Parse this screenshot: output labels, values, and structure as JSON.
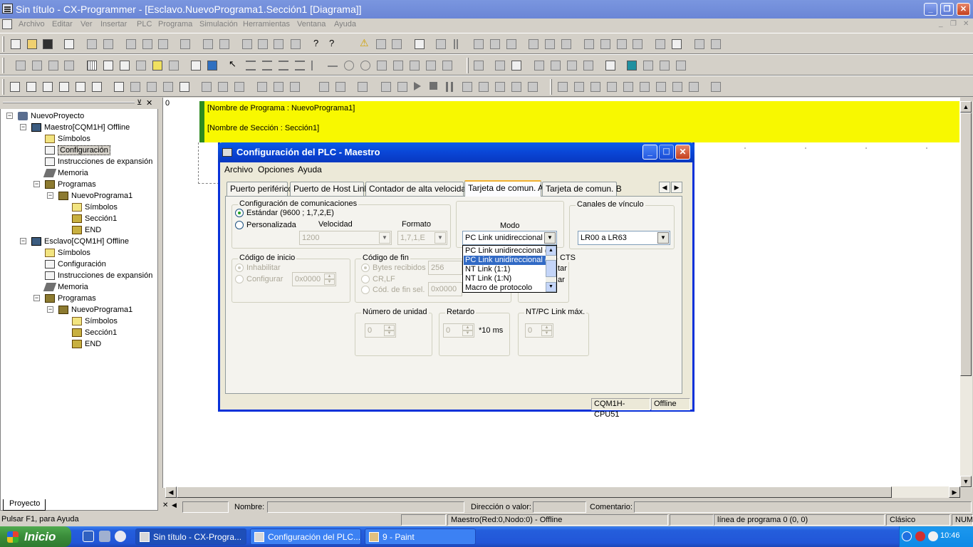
{
  "window": {
    "title": "Sin título - CX-Programmer - [Esclavo.NuevoPrograma1.Sección1 [Diagrama]]"
  },
  "menu": [
    "Archivo",
    "Editar",
    "Ver",
    "Insertar",
    "PLC",
    "Programa",
    "Simulación",
    "Herramientas",
    "Ventana",
    "Ayuda"
  ],
  "project_tree": {
    "items": [
      {
        "label": "NuevoProyecto",
        "icon": "network-icon"
      },
      {
        "label": "Maestro[CQM1H] Offline",
        "icon": "plc-icon"
      },
      {
        "label": "Símbolos",
        "icon": "symbols-icon"
      },
      {
        "label": "Configuración",
        "icon": "config-icon"
      },
      {
        "label": "Instrucciones de expansión",
        "icon": "instructions-icon"
      },
      {
        "label": "Memoria",
        "icon": "memory-icon"
      },
      {
        "label": "Programas",
        "icon": "programs-icon"
      },
      {
        "label": "NuevoPrograma1",
        "icon": "program-icon"
      },
      {
        "label": "Símbolos",
        "icon": "symbols-icon"
      },
      {
        "label": "Sección1",
        "icon": "section-icon"
      },
      {
        "label": "END",
        "icon": "section-icon"
      },
      {
        "label": "Esclavo[CQM1H] Offline",
        "icon": "plc-icon"
      },
      {
        "label": "Símbolos",
        "icon": "symbols-icon"
      },
      {
        "label": "Configuración",
        "icon": "config-icon"
      },
      {
        "label": "Instrucciones de expansión",
        "icon": "instructions-icon"
      },
      {
        "label": "Memoria",
        "icon": "memory-icon"
      },
      {
        "label": "Programas",
        "icon": "programs-icon"
      },
      {
        "label": "NuevoPrograma1",
        "icon": "program-icon"
      },
      {
        "label": "Símbolos",
        "icon": "symbols-icon"
      },
      {
        "label": "Sección1",
        "icon": "section-icon"
      },
      {
        "label": "END",
        "icon": "section-icon"
      }
    ],
    "tab_label": "Proyecto"
  },
  "diagram": {
    "rung_number": "0",
    "program_name": "[Nombre de Programa : NuevoPrograma1]",
    "section_name": "[Nombre de Sección : Sección1]"
  },
  "inner_status": {
    "nombre_label": "Nombre:",
    "direccion_label": "Dirección o valor:",
    "comentario_label": "Comentario:"
  },
  "statusbar": {
    "help": "Pulsar F1, para Ayuda",
    "plc": "Maestro(Red:0,Nodo:0) - Offline",
    "line": "línea de programa 0 (0, 0)",
    "mode": "Clásico",
    "num": "NUM"
  },
  "dialog": {
    "title": "Configuración del PLC - Maestro",
    "menu": [
      "Archivo",
      "Opciones",
      "Ayuda"
    ],
    "tabs": [
      "Puerto periférico",
      "Puerto de Host Link",
      "Contador de alta velocidad",
      "Tarjeta de comun. A",
      "Tarjeta de comun. B"
    ],
    "comms_group": "Configuración de comunicaciones",
    "standard_option": "Estándar (9600 ; 1,7,2,E)",
    "custom_option": "Personalizada",
    "speed_label": "Velocidad",
    "speed_value": "1200",
    "format_label": "Formato",
    "format_value": "1,7,1,E",
    "mode_label": "Modo",
    "mode_value": "PC Link unidireccional (",
    "mode_options": [
      "PC Link unidireccional (",
      "PC Link unidireccional (",
      "NT Link (1:1)",
      "NT Link (1:N)",
      "Macro de protocolo"
    ],
    "link_channels_group": "Canales de vínculo",
    "link_channels_value": "LR00 a LR63",
    "start_code_group": "Código de inicio",
    "start_enable": "Inhabilitar",
    "start_config": "Configurar",
    "start_value": "0x0000",
    "end_code_group": "Código de fin",
    "end_bytes": "Bytes recibidos",
    "end_bytes_value": "256",
    "end_crlf": "CR,LF",
    "end_sel": "Cód. de fin sel.",
    "end_sel_value": "0x0000",
    "cts_group": "CTS",
    "cts_opt1": "tar",
    "cts_opt2": "ar",
    "unit_group": "Número de unidad",
    "unit_value": "0",
    "delay_group": "Retardo",
    "delay_value": "0",
    "delay_unit": "*10 ms",
    "ntpc_group": "NT/PC Link máx.",
    "ntpc_value": "0",
    "status_model": "CQM1H-CPU51",
    "status_state": "Offline"
  },
  "taskbar": {
    "start": "Inicio",
    "tasks": [
      "Sin título - CX-Progra...",
      "Configuración del PLC....",
      "9 - Paint"
    ],
    "clock": "10:46"
  }
}
